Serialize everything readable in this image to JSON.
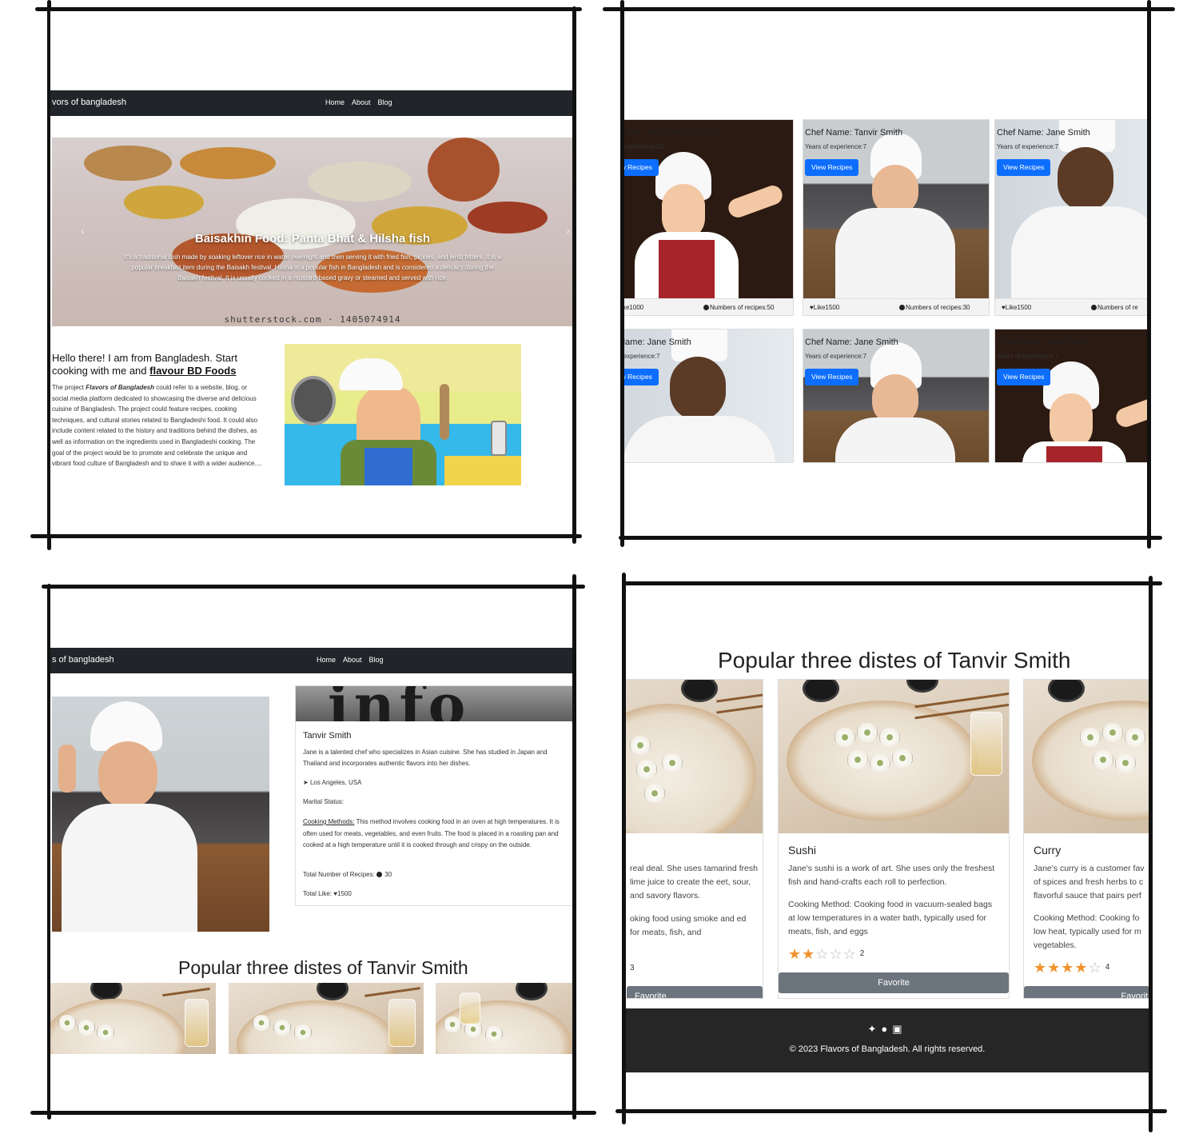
{
  "brand": {
    "p1": "vors of bangladesh",
    "p3": "s of bangladesh"
  },
  "nav": {
    "home": "Home",
    "about": "About",
    "blog": "Blog"
  },
  "hero": {
    "title": "Baisakhin Food: Panta Bhat & Hilsha fish",
    "text": "It's a traditional dish made by soaking leftover rice in water overnight and then serving it with fried fish, pickles, and lentil fritters. It is a popular breakfast item during the Baisakh festival. Hilsha is a popular fish in Bangladesh and is considered a delicacy during the Baisakh festival. It is usually cooked in a mustard-based gravy or steamed and served with rice.",
    "watermark": "shutterstock.com · 1405074914"
  },
  "intro": {
    "heading": "Hello there! I am from Bangladesh. Start cooking with me and",
    "heading_link": "flavour BD Foods",
    "body_prefix": "The project",
    "body_bold": "Flavors of Bangladesh",
    "body": "could refer to a website, blog, or social media platform dedicated to showcasing the diverse and delicious cuisine of Bangladesh. The project could feature recipes, cooking techniques, and cultural stories related to Bangladeshi food. It could also include content related to the history and traditions behind the dishes, as well as information on the ingredients used in Bangladeshi cooking. The goal of the project would be to promote and celebrate the unique and vibrant food culture of Bangladesh and to share it with a wider audience...."
  },
  "chefs": [
    {
      "name": "ef Name: Mohamad Abdulla",
      "years": "rs of experience:10",
      "button": "iew Recipes",
      "likes": "Like1000",
      "recipes": "Numbers of recipes:50"
    },
    {
      "name": "Chef Name: Tanvir Smith",
      "years": "Years of experience:7",
      "button": "View Recipes",
      "likes": "Like1500",
      "recipes": "Numbers of recipes:30"
    },
    {
      "name": "Chef Name: Jane Smith",
      "years": "Years of experience:7",
      "button": "View Recipes",
      "likes": "Like1500",
      "recipes": "Numbers of re"
    },
    {
      "name": "ef Name: Jane Smith",
      "years": "rs of experience:7",
      "button": "iew Recipes"
    },
    {
      "name": "Chef Name: Jane Smith",
      "years": "Years of experience:7",
      "button": "View Recipes"
    },
    {
      "name": "Chef Name: Jane Smith",
      "years": "Years of experience:7",
      "button": "View Recipes"
    }
  ],
  "profile": {
    "banner": "info",
    "name": "Tanvir Smith",
    "bio": "Jane is a talented chef who specializes in Asian cuisine. She has studied in Japan and Thailand and incorporates authentic flavors into her dishes.",
    "location": "Los Angeles, USA",
    "marital": "Marital Status:",
    "method_label": "Cooking Methods:",
    "method_text": "This method involves cooking food in an oven at high temperatures. It is often used for meats, vegetables, and even fruits. The food is placed in a roasting pan and cooked at a high temperature until it is cooked through and crispy on the outside.",
    "recipes_label": "Total Number of Recipes:",
    "recipes_value": "30",
    "likes_label": "Total Like:",
    "likes_value": "1500"
  },
  "popular_title": "Popular three distes of Tanvir Smith",
  "dishes": [
    {
      "title": "",
      "desc": "real deal. She uses tamarind fresh lime juice to create the eet, sour, and savory flavors.",
      "method": "oking food using smoke and ed for meats, fish, and",
      "rating": 3,
      "rating_label": "3",
      "button": "Favorite"
    },
    {
      "title": "Sushi",
      "desc": "Jane's sushi is a work of art. She uses only the freshest fish and hand-crafts each roll to perfection.",
      "method": "Cooking Method: Cooking food in vacuum-sealed bags at low temperatures in a water bath, typically used for meats, fish, and eggs",
      "rating": 2,
      "rating_label": "2",
      "button": "Favorite"
    },
    {
      "title": "Curry",
      "desc": "Jane's curry is a customer fav of spices and fresh herbs to c flavorful sauce that pairs perf",
      "method": "Cooking Method: Cooking fo low heat, typically used for m vegetables.",
      "rating": 4,
      "rating_label": "4",
      "button": "Favorit"
    }
  ],
  "footer": {
    "icons": [
      "twitter-icon",
      "github-icon",
      "instagram-icon"
    ],
    "copyright": "© 2023 Flavors of Bangladesh. All rights reserved."
  },
  "colors": {
    "navbar": "#212529",
    "primary_button": "#0d6efd",
    "favorite_button": "#6c757d",
    "star": "#f0922b",
    "footer": "#262626"
  }
}
